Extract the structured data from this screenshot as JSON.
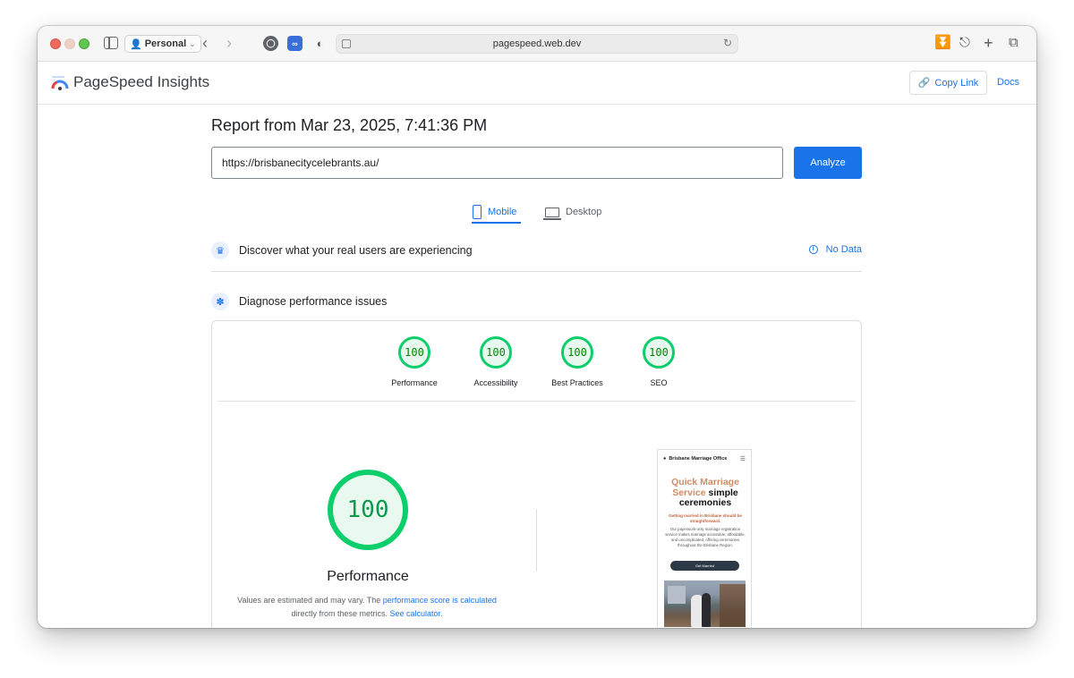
{
  "browser": {
    "profile_label": "Personal",
    "address": "pagespeed.web.dev"
  },
  "app": {
    "title": "PageSpeed Insights",
    "copy_link_label": "Copy Link",
    "docs_label": "Docs"
  },
  "report": {
    "title": "Report from Mar 23, 2025, 7:41:36 PM",
    "url_value": "https://brisbanecitycelebrants.au/",
    "analyze_label": "Analyze"
  },
  "tabs": [
    {
      "label": "Mobile",
      "active": true,
      "icon": "phone-icon"
    },
    {
      "label": "Desktop",
      "active": false,
      "icon": "laptop-icon"
    }
  ],
  "sections": {
    "real_users": {
      "label": "Discover what your real users are experiencing",
      "status": "No Data"
    },
    "diagnose": {
      "label": "Diagnose performance issues"
    }
  },
  "scores": [
    {
      "label": "Performance",
      "value": "100"
    },
    {
      "label": "Accessibility",
      "value": "100"
    },
    {
      "label": "Best Practices",
      "value": "100"
    },
    {
      "label": "SEO",
      "value": "100"
    }
  ],
  "performance": {
    "score": "100",
    "label": "Performance",
    "note_prefix": "Values are estimated and may vary. The ",
    "note_link1": "performance score is calculated",
    "note_middle": "directly from these metrics. ",
    "note_link2": "See calculator."
  },
  "thumbnail": {
    "site_name": "Brisbane Marriage Office",
    "headline_accent": "Quick Marriage Service",
    "headline_rest": " simple ceremonies",
    "subheading": "Getting married in Brisbane should be straightforward.",
    "body": "Our paperwork-only marriage registration service makes marriage accessible, affordable, and uncomplicated, offering ceremonies throughout the Brisbane Region.",
    "button": "Get Married"
  },
  "colors": {
    "accent": "#1a73e8",
    "pass_green": "#0cce6b"
  }
}
